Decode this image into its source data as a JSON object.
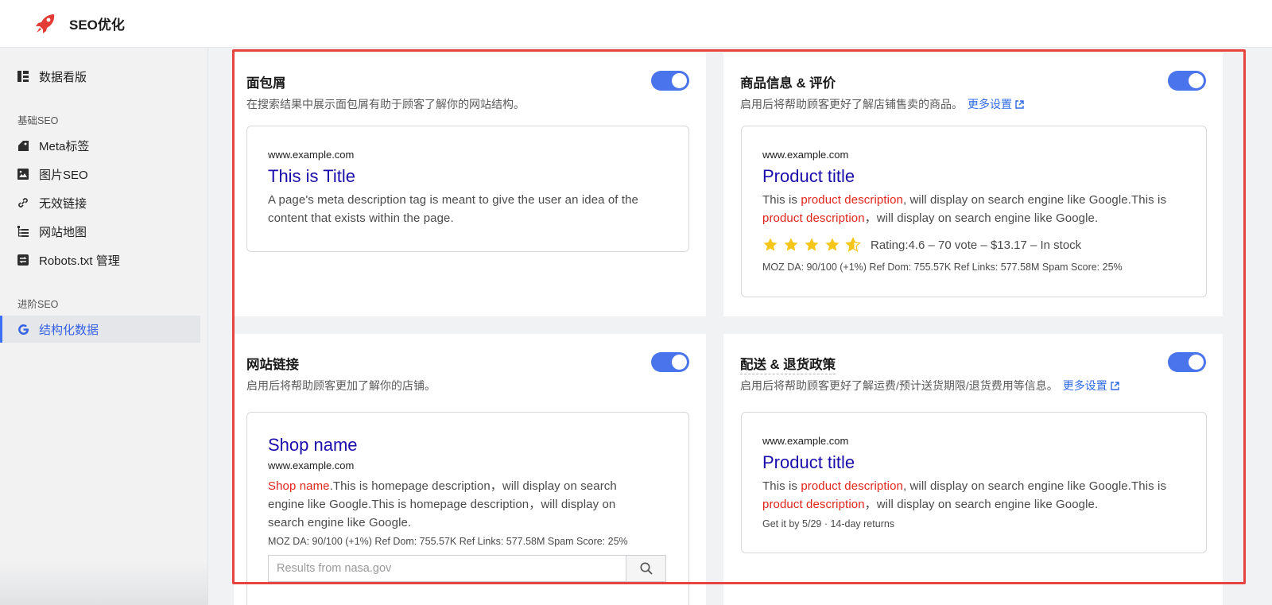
{
  "app": {
    "title": "SEO优化",
    "logo_icon": "rocket-icon",
    "accent": "#3b6ff5"
  },
  "sidebar": {
    "dashboard": {
      "label": "数据看版",
      "icon": "dashboard-icon"
    },
    "section_basic": "基础SEO",
    "basic_items": [
      {
        "label": "Meta标签",
        "icon": "tag-icon"
      },
      {
        "label": "图片SEO",
        "icon": "image-icon"
      },
      {
        "label": "无效链接",
        "icon": "link-icon"
      },
      {
        "label": "网站地图",
        "icon": "sitemap-icon"
      },
      {
        "label": "Robots.txt 管理",
        "icon": "robots-icon"
      }
    ],
    "section_advanced": "进阶SEO",
    "advanced_items": [
      {
        "label": "结构化数据",
        "icon": "google-icon",
        "active": true
      }
    ]
  },
  "cards": {
    "breadcrumb": {
      "title": "面包屑",
      "desc": "在搜索结果中展示面包屑有助于顾客了解你的网站结构。",
      "enabled": true,
      "preview": {
        "url": "www.example.com",
        "title": "This is Title",
        "desc": "A page's meta description tag is meant to give the user an idea of the content that exists within the page."
      }
    },
    "product": {
      "title": "商品信息 & 评价",
      "desc": "启用后将帮助顾客更好了解店铺售卖的商品。",
      "more": "更多设置",
      "enabled": true,
      "preview": {
        "url": "www.example.com",
        "title": "Product title",
        "desc_1": "This is ",
        "desc_2": "product description",
        "desc_3": ", will display on search engine like Google.This is ",
        "desc_4": "product description",
        "desc_5": "，will display on search engine like Google.",
        "rating_value": 4.6,
        "rating_text": "Rating:4.6 – 70 vote – $13.17 – In stock",
        "moz": "MOZ DA: 90/100 (+1%) Ref Dom: 755.57K Ref Links: 577.58M Spam Score: 25%"
      }
    },
    "sitelinks": {
      "title": "网站链接",
      "desc": "启用后将帮助顾客更加了解你的店铺。",
      "enabled": true,
      "preview": {
        "title": "Shop name",
        "url": "www.example.com",
        "desc_hl": "Shop name",
        "desc_rest": ".This is homepage description，will display on search engine like Google.This is homepage description，will display on search engine like Google.",
        "moz": "MOZ DA: 90/100 (+1%) Ref Dom: 755.57K Ref Links: 577.58M Spam Score: 25%",
        "search_placeholder": "Results from nasa.gov"
      }
    },
    "shipping": {
      "title": "配送 & 退货政策",
      "desc": "启用后将帮助顾客更好了解运费/预计送货期限/退货费用等信息。",
      "more": "更多设置",
      "enabled": true,
      "preview": {
        "url": "www.example.com",
        "title": "Product title",
        "desc_1": "This is ",
        "desc_2": "product description",
        "desc_3": ", will display on search engine like Google.This is ",
        "desc_4": "product description",
        "desc_5": "，will display on search engine like Google.",
        "delivery": "Get it by 5/29 · 14-day returns"
      }
    }
  }
}
